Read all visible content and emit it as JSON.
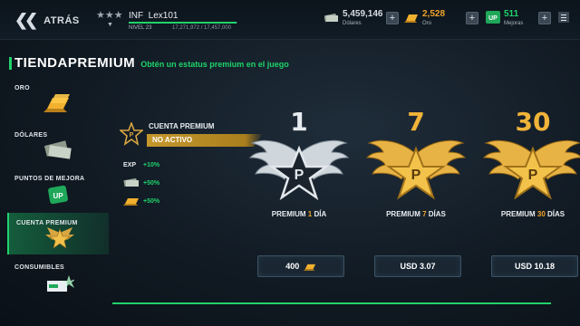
{
  "header": {
    "back_label": "ATRÁS",
    "player": {
      "rank_prefix": "INF",
      "name": "Lex101",
      "level": "NIVEL 23",
      "xp": "17,271,972 / 17,457,000",
      "xp_progress": 0.99
    },
    "resources": [
      {
        "name": "dollars",
        "value": "5,459,146",
        "label": "Dólares",
        "color": "#d6dde3"
      },
      {
        "name": "gold",
        "value": "2,528",
        "label": "Oro",
        "color": "#f0a32a"
      },
      {
        "name": "upgrades",
        "value": "511",
        "label": "Mejoras",
        "color": "#1fd36a"
      }
    ]
  },
  "page": {
    "title_a": "TIENDA",
    "title_b": "PREMIUM",
    "subtitle": "Obtén un estatus premium en el juego"
  },
  "sidebar": {
    "items": [
      {
        "label": "ORO",
        "icon": "gold-bars-icon"
      },
      {
        "label": "DÓLARES",
        "icon": "dollar-bills-icon"
      },
      {
        "label": "PUNTOS DE MEJORA",
        "icon": "upgrade-points-icon"
      },
      {
        "label": "CUENTA PREMIUM",
        "icon": "premium-wings-icon",
        "active": true
      },
      {
        "label": "CONSUMIBLES",
        "icon": "consumables-icon"
      }
    ]
  },
  "status": {
    "title": "CUENTA PREMIUM",
    "state": "NO ACTIVO",
    "bonuses": [
      {
        "key": "EXP",
        "value": "+10%"
      },
      {
        "key": "",
        "value": "+50%",
        "icon": "dollar-bills-icon"
      },
      {
        "key": "",
        "value": "+50%",
        "icon": "gold-bars-icon"
      }
    ]
  },
  "cards": [
    {
      "number": "1",
      "name_a": "PREMIUM ",
      "name_days": "1",
      "name_b": " DÍA",
      "price": "400",
      "price_icon": "gold-bars-icon",
      "tint": "silver"
    },
    {
      "number": "7",
      "name_a": "PREMIUM ",
      "name_days": "7",
      "name_b": " DÍAS",
      "price": "USD 3.07",
      "tint": "gold"
    },
    {
      "number": "30",
      "name_a": "PREMIUM ",
      "name_days": "30",
      "name_b": " DÍAS",
      "price": "USD 10.18",
      "tint": "gold"
    }
  ],
  "colors": {
    "accent": "#1fd36a",
    "gold": "#f0a32a",
    "silver": "#c9d1d8"
  }
}
